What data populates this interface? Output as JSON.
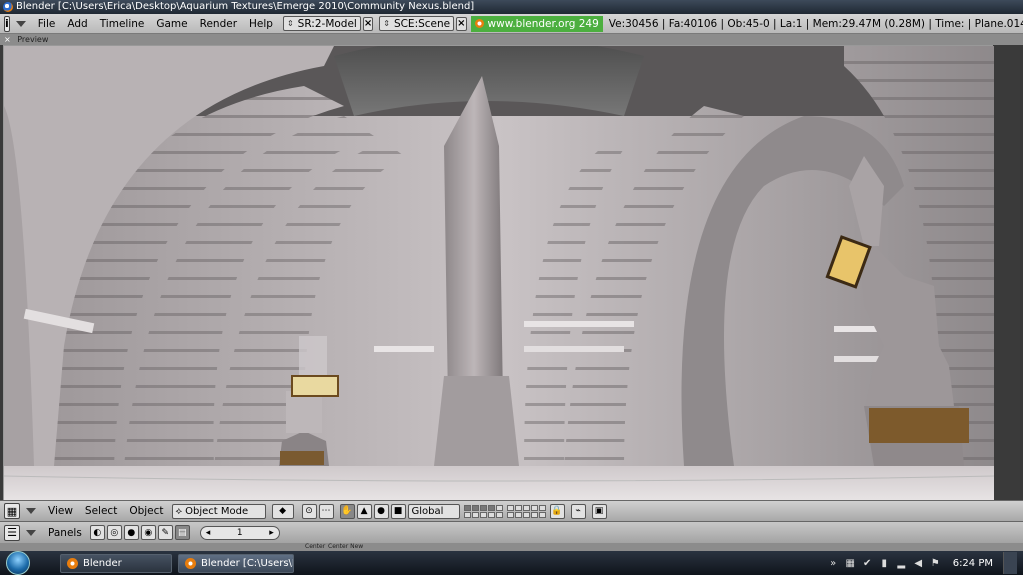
{
  "window": {
    "title": "Blender [C:\\Users\\Erica\\Desktop\\Aquarium Textures\\Emerge 2010\\Community Nexus.blend]"
  },
  "info_header": {
    "menus": [
      "File",
      "Add",
      "Timeline",
      "Game",
      "Render",
      "Help"
    ],
    "screen": "SR:2-Model",
    "scene": "SCE:Scene",
    "link": "www.blender.org 249",
    "stats": "Ve:30456 | Fa:40106 | Ob:45-0 | La:1  | Mem:29.47M (0.28M)  | Time: | Plane.014"
  },
  "viewport": {
    "label": "Preview",
    "close_glyph": "×"
  },
  "view3d_header": {
    "menus": [
      "View",
      "Select",
      "Object"
    ],
    "mode": "Object Mode",
    "orientation": "Global"
  },
  "buttons_header": {
    "label": "Panels",
    "frame_value": "1",
    "strip_labels": [
      "Center",
      "Center New"
    ]
  },
  "taskbar": {
    "tasks": [
      "Blender",
      "Blender [C:\\Users\\Er..."
    ],
    "clock": "6:24 PM"
  },
  "colors": {
    "link_bg": "#4caf3f",
    "header_bg": "#c4c4c4",
    "taskbar_bg": "#1a222c"
  }
}
